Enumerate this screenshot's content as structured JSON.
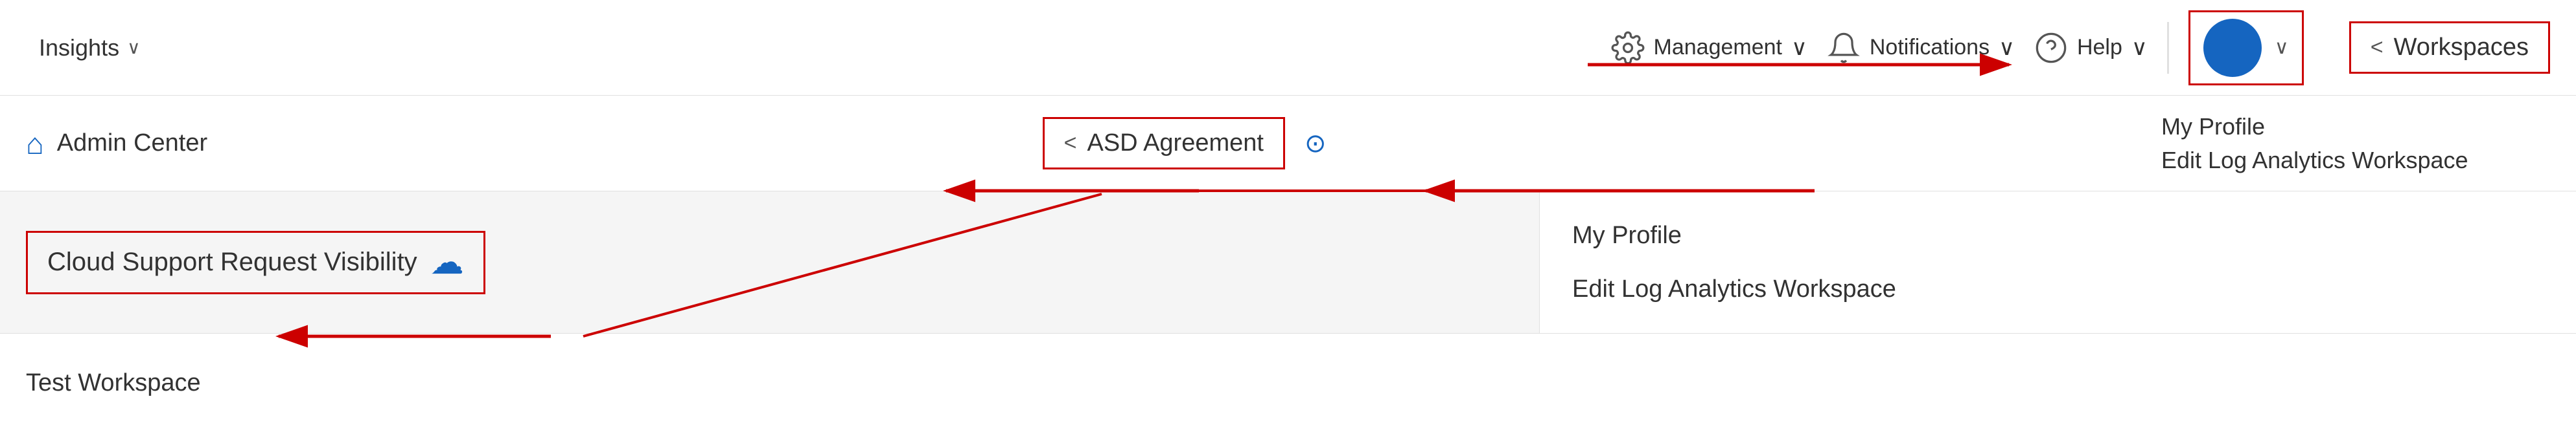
{
  "topNav": {
    "insights_label": "Insights",
    "management_label": "Management",
    "notifications_label": "Notifications",
    "help_label": "Help",
    "chevron": "∨"
  },
  "secondRow": {
    "admin_center_label": "Admin Center",
    "asd_agreement_label": "ASD Agreement",
    "workspaces_label": "Workspaces"
  },
  "thirdRow": {
    "cloud_support_label": "Cloud Support Request Visibility",
    "my_profile_label": "My Profile",
    "edit_log_label": "Edit Log Analytics Workspace"
  },
  "fourthRow": {
    "test_workspace_label": "Test Workspace"
  },
  "colors": {
    "accent": "#1565C0",
    "red": "#cc0000",
    "text": "#323232"
  }
}
